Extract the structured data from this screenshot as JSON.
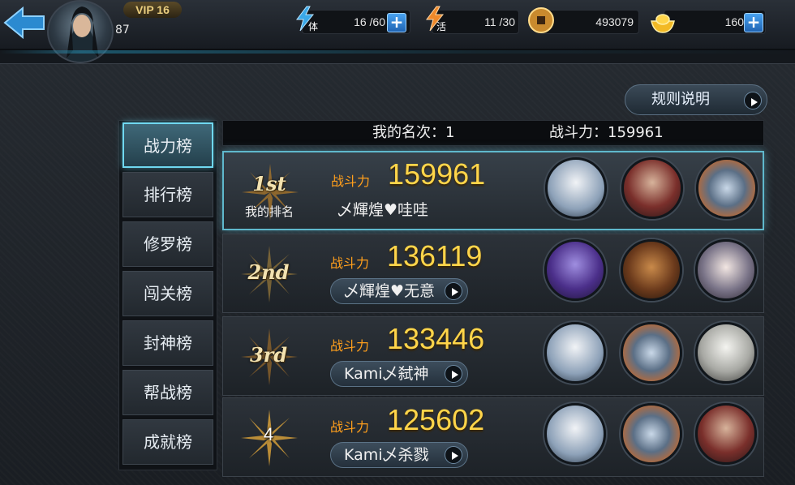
{
  "header": {
    "vip": "VIP 16",
    "level": "87",
    "stamina": {
      "icon_text": "体",
      "value": "16 /60"
    },
    "vitality": {
      "icon_text": "活",
      "value": "11 /30"
    },
    "coins": {
      "value": "493079"
    },
    "gold": {
      "value": "160"
    },
    "plus": "+"
  },
  "rules_button": "规则说明",
  "tabs": [
    {
      "label": "战力榜",
      "active": true
    },
    {
      "label": "排行榜"
    },
    {
      "label": "修罗榜"
    },
    {
      "label": "闯关榜"
    },
    {
      "label": "封神榜"
    },
    {
      "label": "帮战榜"
    },
    {
      "label": "成就榜"
    }
  ],
  "summary": {
    "my_rank": "我的名次：1",
    "power": "战斗力：159961"
  },
  "power_label": "战斗力",
  "my_rank_label": "我的排名",
  "rows": [
    {
      "place": "1st",
      "power": "159961",
      "name": "乄輝煌♥哇哇",
      "heroes": [
        "oni-mask-hero",
        "swordsman-hero",
        "clawed-hand-hero"
      ]
    },
    {
      "place": "2nd",
      "power": "136119",
      "name": "乄輝煌♥无意",
      "heroes": [
        "purple-demon-hero",
        "beast-warrior-hero",
        "hatted-girl-hero"
      ]
    },
    {
      "place": "3rd",
      "power": "133446",
      "name": "Kami乄弑神",
      "heroes": [
        "oni-mask-hero",
        "clawed-hand-hero",
        "white-haired-elder-hero"
      ]
    },
    {
      "place": "4",
      "power": "125602",
      "name": "Kami乄杀戮",
      "heroes": [
        "oni-mask-hero",
        "clawed-hand-hero",
        "swordsman-hero"
      ]
    }
  ]
}
